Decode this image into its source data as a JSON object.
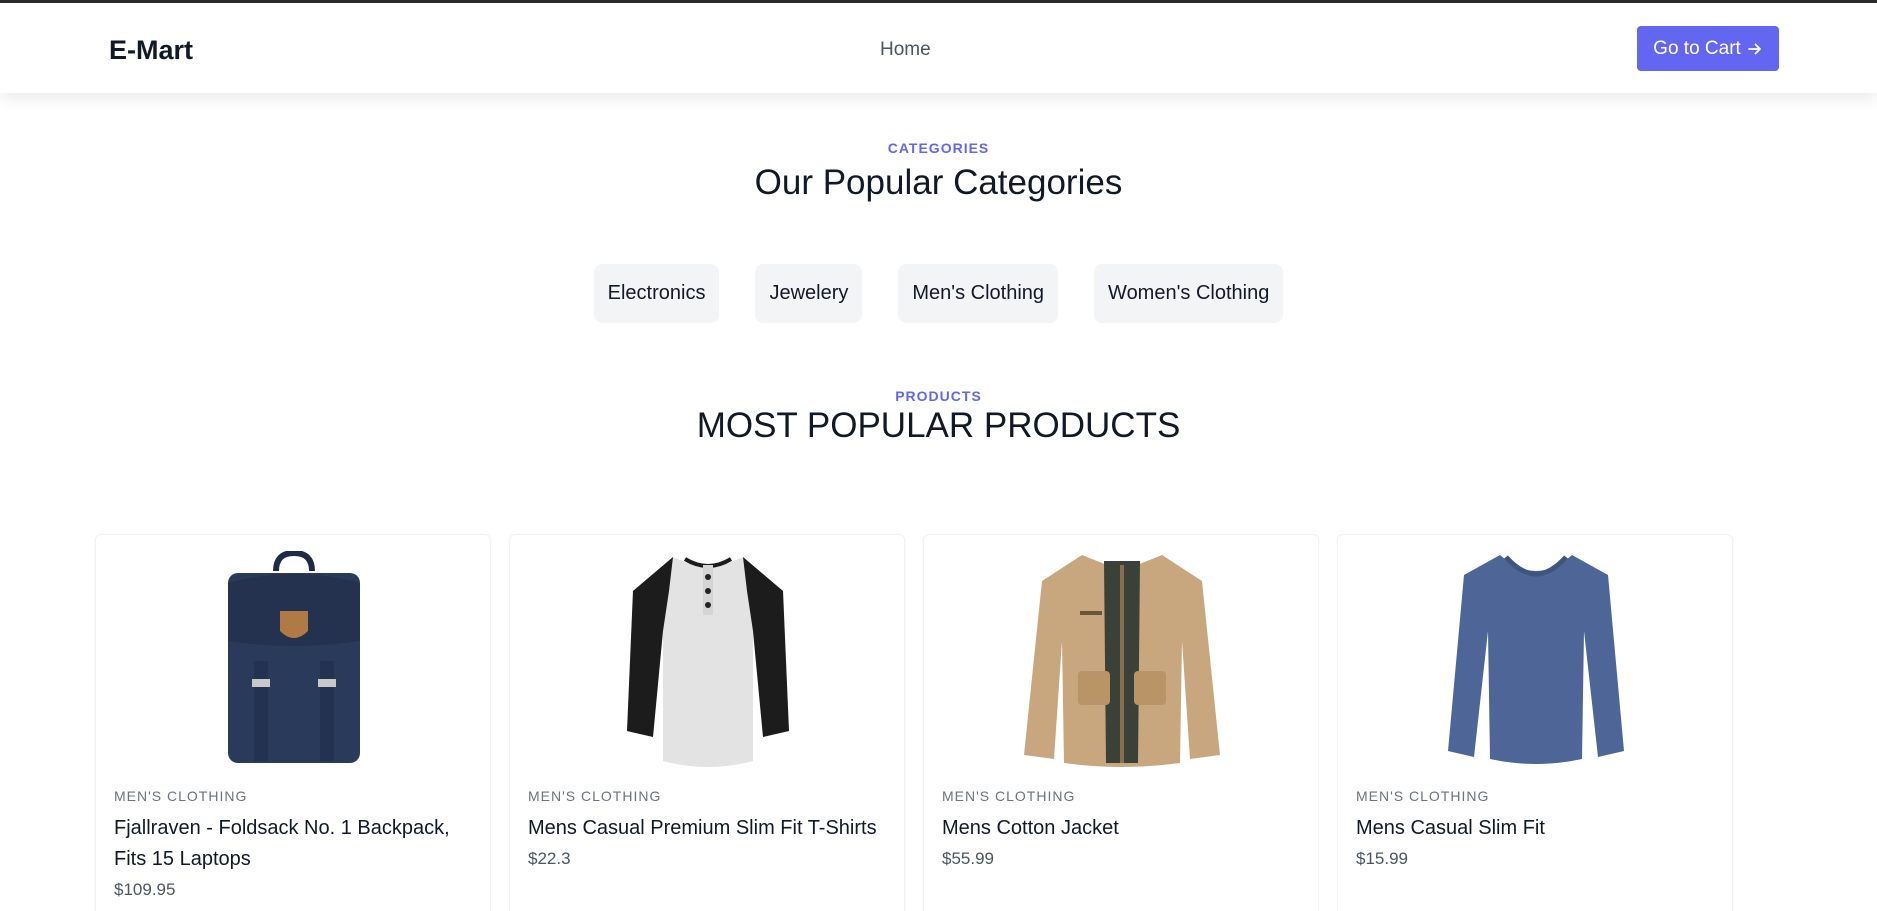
{
  "header": {
    "logo": "E-Mart",
    "nav_home": "Home",
    "cart_button": "Go to Cart"
  },
  "categories_section": {
    "eyebrow": "CATEGORIES",
    "title": "Our Popular Categories",
    "items": [
      "Electronics",
      "Jewelery",
      "Men's Clothing",
      "Women's Clothing"
    ]
  },
  "products_section": {
    "eyebrow": "PRODUCTS",
    "title": "MOST POPULAR PRODUCTS",
    "items": [
      {
        "category": "MEN'S CLOTHING",
        "title": "Fjallraven - Foldsack No. 1 Backpack, Fits 15 Laptops",
        "price": "$109.95"
      },
      {
        "category": "MEN'S CLOTHING",
        "title": "Mens Casual Premium Slim Fit T-Shirts",
        "price": "$22.3"
      },
      {
        "category": "MEN'S CLOTHING",
        "title": "Mens Cotton Jacket",
        "price": "$55.99"
      },
      {
        "category": "MEN'S CLOTHING",
        "title": "Mens Casual Slim Fit",
        "price": "$15.99"
      }
    ]
  },
  "colors": {
    "accent": "#6366f1",
    "text": "#111827",
    "muted": "#6b7280",
    "chip_bg": "#f3f4f6"
  }
}
